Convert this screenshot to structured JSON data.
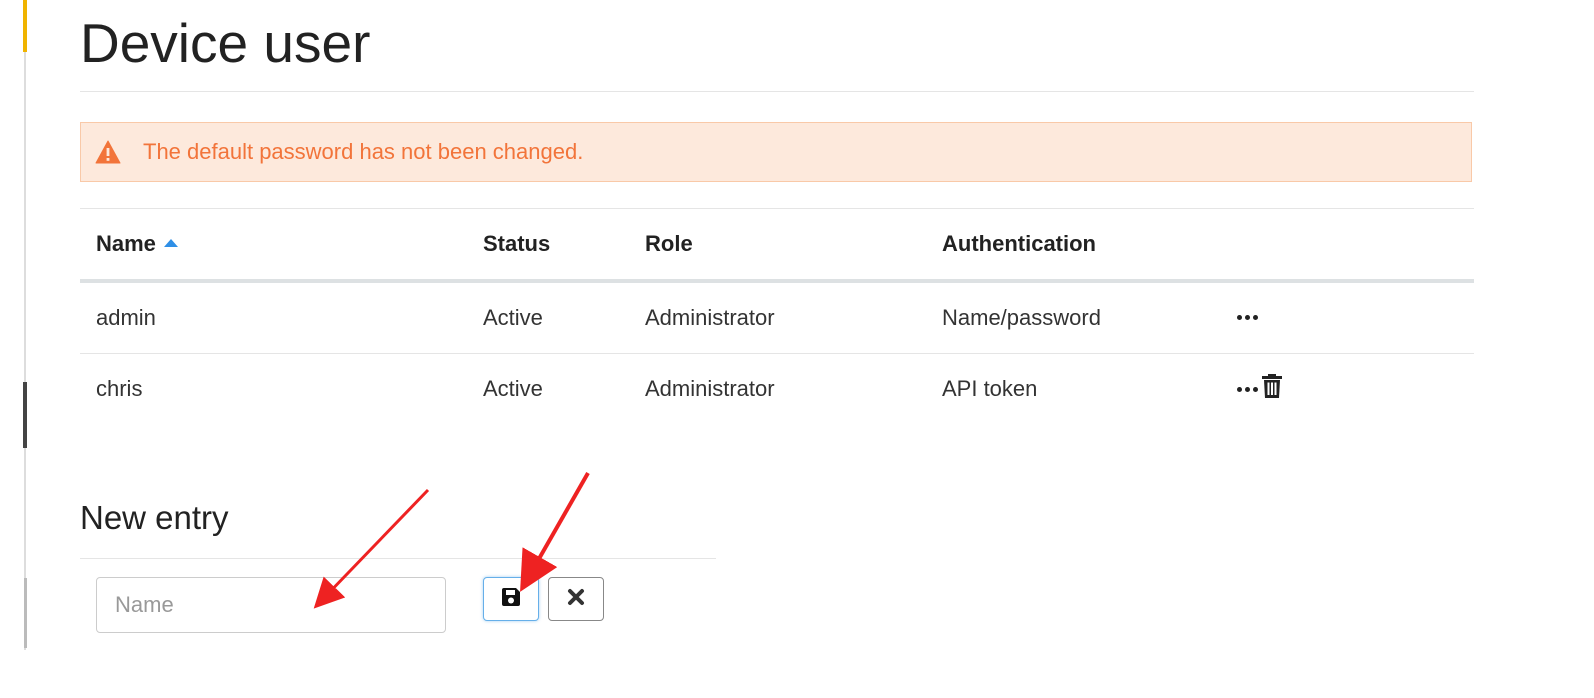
{
  "page": {
    "title": "Device user"
  },
  "alert": {
    "icon": "warning-triangle-icon",
    "text": "The default password has not been changed.",
    "color": "#f2743a",
    "background": "#fde9dc"
  },
  "table": {
    "columns": [
      {
        "label": "Name",
        "sorted": "ascending"
      },
      {
        "label": "Status"
      },
      {
        "label": "Role"
      },
      {
        "label": "Authentication"
      },
      {
        "label": ""
      }
    ],
    "rows": [
      {
        "name": "admin",
        "status": "Active",
        "role": "Administrator",
        "authentication": "Name/password",
        "actions": [
          "more-icon"
        ]
      },
      {
        "name": "chris",
        "status": "Active",
        "role": "Administrator",
        "authentication": "API token",
        "actions": [
          "more-icon",
          "trash-icon"
        ]
      }
    ]
  },
  "new_entry": {
    "title": "New entry",
    "name_placeholder": "Name",
    "name_value": "",
    "save_icon": "save-icon",
    "cancel_icon": "close-icon"
  },
  "colors": {
    "accent_blue": "#2f8fe6",
    "annotation_red": "#ee2222"
  }
}
